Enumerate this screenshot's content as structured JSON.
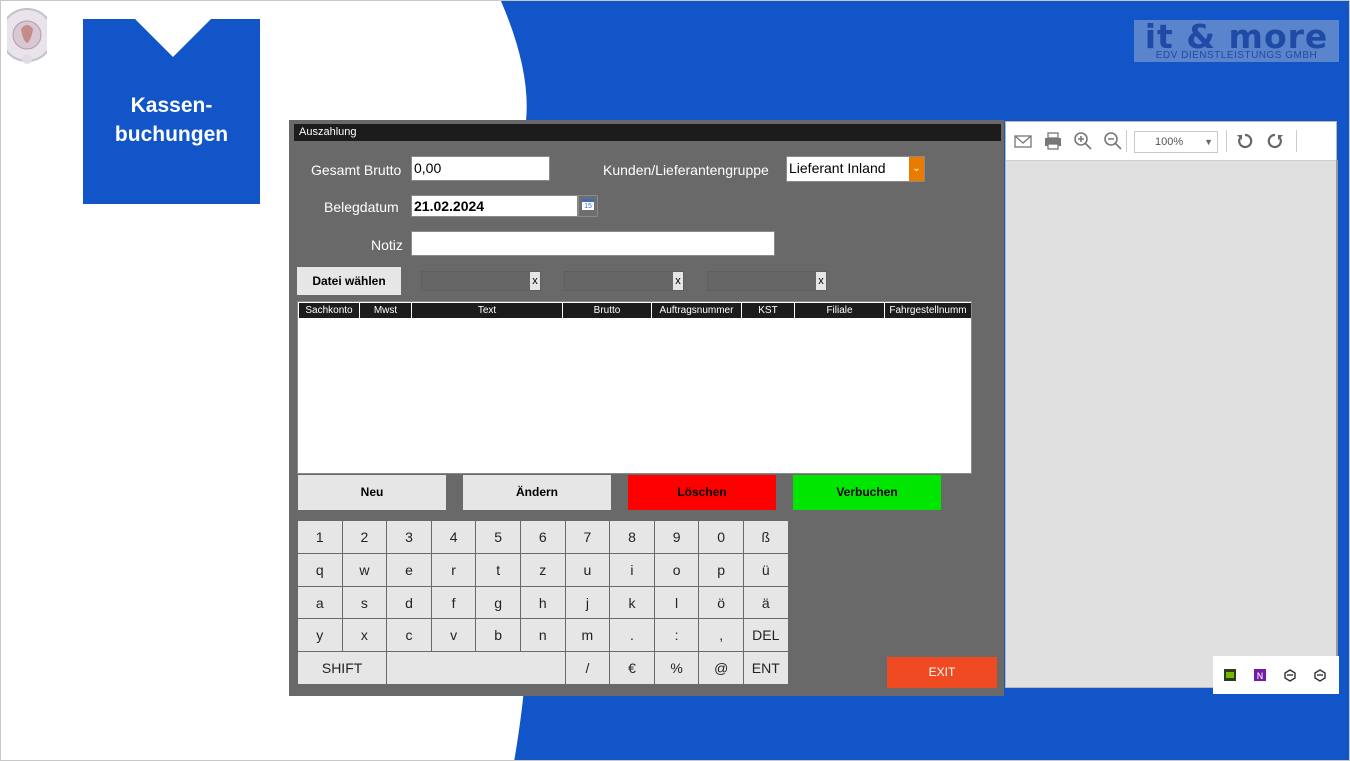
{
  "slide": {
    "title": "Kassen-\nbuchungen",
    "brand_main": "it & more",
    "brand_sub": "EDV DIENSTLEISTUNGS GMBH",
    "colors": {
      "blue": "#1155c8",
      "window_gray": "#696969",
      "delete_red": "#ff0000",
      "post_green": "#00e600",
      "exit_orange": "#f04a23",
      "combo_orange": "#e97b00"
    }
  },
  "window": {
    "title": "Auszahlung",
    "form": {
      "gross_label": "Gesamt Brutto",
      "gross_value": "0,00",
      "group_label": "Kunden/Lieferantengruppe",
      "group_value": "Lieferant Inland",
      "date_label": "Belegdatum",
      "date_value": "21.02.2024",
      "calendar_day": "15",
      "note_label": "Notiz",
      "note_value": ""
    },
    "file_button": "Datei wählen",
    "file_remove": "x",
    "columns": [
      "Sachkonto",
      "Mwst",
      "Text",
      "Brutto",
      "Auftragsnummer",
      "KST",
      "Filiale",
      "Fahrgestellnumm"
    ],
    "buttons": {
      "new": "Neu",
      "edit": "Ändern",
      "delete": "Löschen",
      "post": "Verbuchen",
      "exit": "EXIT"
    },
    "keyboard": [
      [
        "1",
        "2",
        "3",
        "4",
        "5",
        "6",
        "7",
        "8",
        "9",
        "0",
        "ß"
      ],
      [
        "q",
        "w",
        "e",
        "r",
        "t",
        "z",
        "u",
        "i",
        "o",
        "p",
        "ü"
      ],
      [
        "a",
        "s",
        "d",
        "f",
        "g",
        "h",
        "j",
        "k",
        "l",
        "ö",
        "ä"
      ],
      [
        "y",
        "x",
        "c",
        "v",
        "b",
        "n",
        "m",
        ".",
        ":",
        ",",
        "DEL"
      ],
      [
        "SHIFT",
        "",
        "/",
        "€",
        "%",
        "@",
        "ENT"
      ]
    ]
  },
  "viewer": {
    "zoom": "100%",
    "icons": [
      "mail-icon",
      "print-icon",
      "zoom-in-icon",
      "zoom-out-icon",
      "rotate-left-icon",
      "rotate-right-icon"
    ]
  },
  "tray": {
    "icons": [
      "nvidia-icon",
      "onenote-icon",
      "app-icon",
      "app-icon"
    ]
  }
}
